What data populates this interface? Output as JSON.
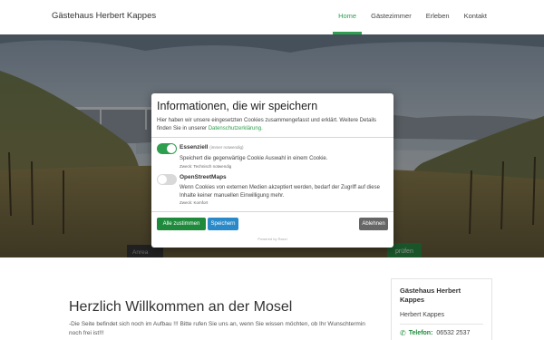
{
  "header": {
    "brand": "Gästehaus Herbert Kappes",
    "nav": [
      "Home",
      "Gästezimmer",
      "Erleben",
      "Kontakt"
    ]
  },
  "hero": {
    "button_left_partial": "Anrea",
    "button_right_partial": "prüfen"
  },
  "cookie_modal": {
    "title": "Informationen, die wir speichern",
    "intro": "Hier haben wir unsere eingesetzten Cookies zusammengefasst und erklärt. Weitere Details finden Sie in unserer ",
    "privacy_link": "Datenschutzerklärung.",
    "options": [
      {
        "name": "Essenziell",
        "note": "(immer notwendig)",
        "description": "Speichert die gegenwärtige Cookie Auswahl in einem Cookie.",
        "purpose": "Zweck: Technisch notwendig",
        "enabled": true
      },
      {
        "name": "OpenStreetMaps",
        "note": "",
        "description": "Wenn Cookies von externen Medien akzeptiert werden, bedarf der Zugriff auf diese Inhalte keiner manuellen Einwilligung mehr.",
        "purpose": "Zweck: Komfort",
        "enabled": false
      }
    ],
    "buttons": {
      "accept_all": "Alle zustimmen",
      "save": "Speichern",
      "reject": "Ablehnen"
    },
    "powered_by": "Powered by Razzi"
  },
  "main": {
    "title": "Herzlich Willkommen an der Mosel",
    "text": "-Die Seite befindet sich noch im Aufbau !!! Bitte rufen Sie uns an, wenn Sie wissen möchten, ob Ihr Wunschtermin noch frei ist!!!"
  },
  "sidebar_card": {
    "title": "Gästehaus Herbert Kappes",
    "owner": "Herbert Kappes",
    "phone_label": "Telefon:",
    "phone": "06532 2537",
    "phone_icon": "phone-icon"
  },
  "colors": {
    "accent": "#2e9e4f",
    "save_button": "#2a89c9",
    "reject_button": "#666666"
  }
}
